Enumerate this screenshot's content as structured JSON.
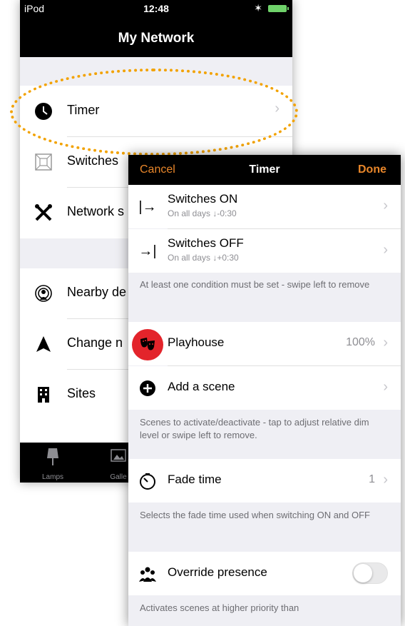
{
  "back_screen": {
    "status": {
      "carrier": "iPod",
      "time": "12:48"
    },
    "title": "My Network",
    "items": [
      {
        "label": "Timer",
        "icon": "clock-icon"
      },
      {
        "label": "Switches",
        "icon": "switch-icon"
      },
      {
        "label": "Network s",
        "icon": "tools-icon"
      },
      {
        "label": "Nearby de",
        "icon": "nearby-icon"
      },
      {
        "label": "Change n",
        "icon": "navigation-icon"
      },
      {
        "label": "Sites",
        "icon": "building-icon"
      }
    ],
    "tabs": [
      {
        "label": "Lamps"
      },
      {
        "label": "Galle"
      }
    ]
  },
  "front_screen": {
    "nav": {
      "cancel": "Cancel",
      "title": "Timer",
      "done": "Done"
    },
    "switches_on": {
      "label": "Switches ON",
      "sub": "On all days  ↓-0:30"
    },
    "switches_off": {
      "label": "Switches OFF",
      "sub": "On all days  ↓+0:30"
    },
    "condition_note": "At least one condition must be set - swipe left to remove",
    "scene": {
      "label": "Playhouse",
      "value": "100%"
    },
    "add_scene": {
      "label": "Add a scene"
    },
    "scenes_note": "Scenes to activate/deactivate - tap to adjust relative dim level or swipe left to remove.",
    "fade": {
      "label": "Fade time",
      "value": "1"
    },
    "fade_note": "Selects the fade time used when switching ON and OFF",
    "override": {
      "label": "Override presence",
      "on": false
    },
    "override_note": "Activates scenes at higher priority than"
  },
  "colors": {
    "accent": "#e8862a",
    "highlight": "#f2a200",
    "badge": "#e3242b"
  }
}
